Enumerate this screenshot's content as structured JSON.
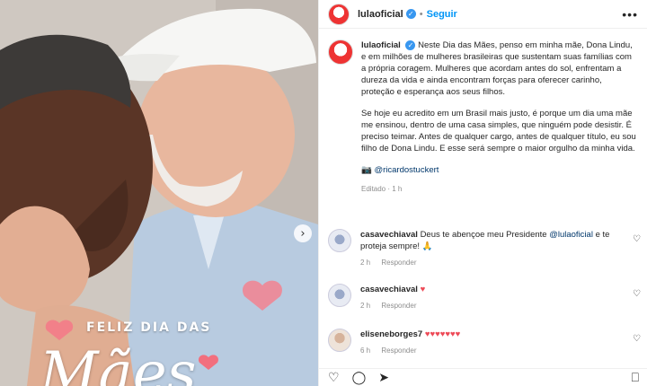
{
  "header": {
    "username": "lulaoficial",
    "verified_glyph": "✓",
    "separator": "•",
    "follow_label": "Seguir",
    "more_glyph": "•••"
  },
  "photo": {
    "overlay_line1": "FELIZ DIA DAS",
    "overlay_line2": "Mães",
    "next_glyph": "›"
  },
  "post": {
    "username": "lulaoficial",
    "caption_p1": "Neste Dia das Mães, penso em minha mãe, Dona Lindu, e em milhões de mulheres brasileiras que sustentam suas famílias com a própria coragem. Mulheres que acordam antes do sol, enfrentam a dureza da vida e ainda encontram forças para oferecer carinho, proteção e esperança aos seus filhos.",
    "caption_p2": "Se hoje eu acredito em um Brasil mais justo, é porque um dia uma mãe me ensinou, dentro de uma casa simples, que ninguém pode desistir. É preciso teimar. Antes de qualquer cargo, antes de qualquer título, eu sou filho de Dona Lindu. E esse será sempre o maior orgulho da minha vida.",
    "photo_credit_glyph": "📷",
    "photo_credit": "@ricardostuckert",
    "meta": "Editado · 1 h"
  },
  "comments": [
    {
      "username": "casavechiaval",
      "text_before": "Deus te abençoe meu Presidente",
      "mention": "@lulaoficial",
      "text_after": "e te proteja sempre! 🙏",
      "time": "2 h",
      "reply": "Responder"
    },
    {
      "username": "casavechiaval",
      "text_before": "♥",
      "mention": "",
      "text_after": "",
      "time": "2 h",
      "reply": "Responder"
    },
    {
      "username": "eliseneborges7",
      "text_before": "♥♥♥♥♥♥♥",
      "mention": "",
      "text_after": "",
      "time": "6 h",
      "reply": "Responder"
    }
  ],
  "icons": {
    "like": "heart-icon",
    "comment": "comment-icon",
    "share": "share-icon",
    "save": "bookmark-icon"
  },
  "action_glyphs": {
    "like": "♡",
    "comment": "◯",
    "share": "➤",
    "save": "⎕",
    "comment_like": "♡"
  },
  "colors": {
    "link_blue": "#0095f6",
    "mention_blue": "#00376b",
    "heart_red": "#ed4956",
    "verified_blue": "#3897f0"
  }
}
